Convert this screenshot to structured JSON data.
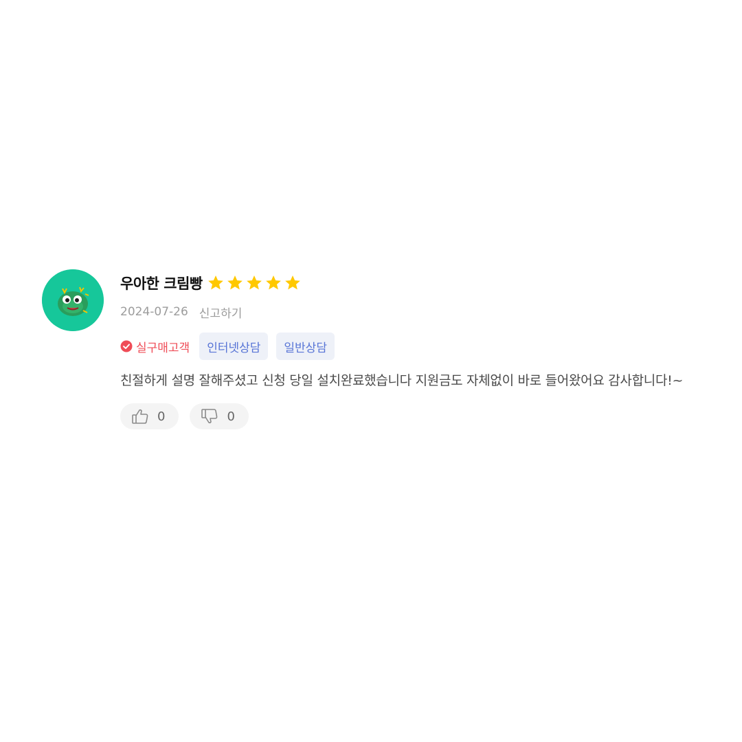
{
  "review": {
    "user_name": "우아한 크림빵",
    "rating": 5,
    "date": "2024-07-26",
    "report_label": "신고하기",
    "verified_label": "실구매고객",
    "tags": [
      "인터넷상담",
      "일반상담"
    ],
    "body": "친절하게 설명 잘해주셨고 신청 당일 설치완료했습니다 지원금도 자체없이 바로 들어왔어요 감사합니다!~",
    "likes": "0",
    "dislikes": "0"
  },
  "icons": {
    "avatar": "green-character-avatar",
    "star": "star-icon",
    "verified": "check-circle-icon",
    "like": "thumbs-up-icon",
    "dislike": "thumbs-down-icon"
  },
  "colors": {
    "star": "#FFC800",
    "verified": "#EF4C57",
    "tag_text": "#5774D6",
    "tag_bg": "#EEF1F8",
    "avatar_bg": "#16C79A"
  }
}
